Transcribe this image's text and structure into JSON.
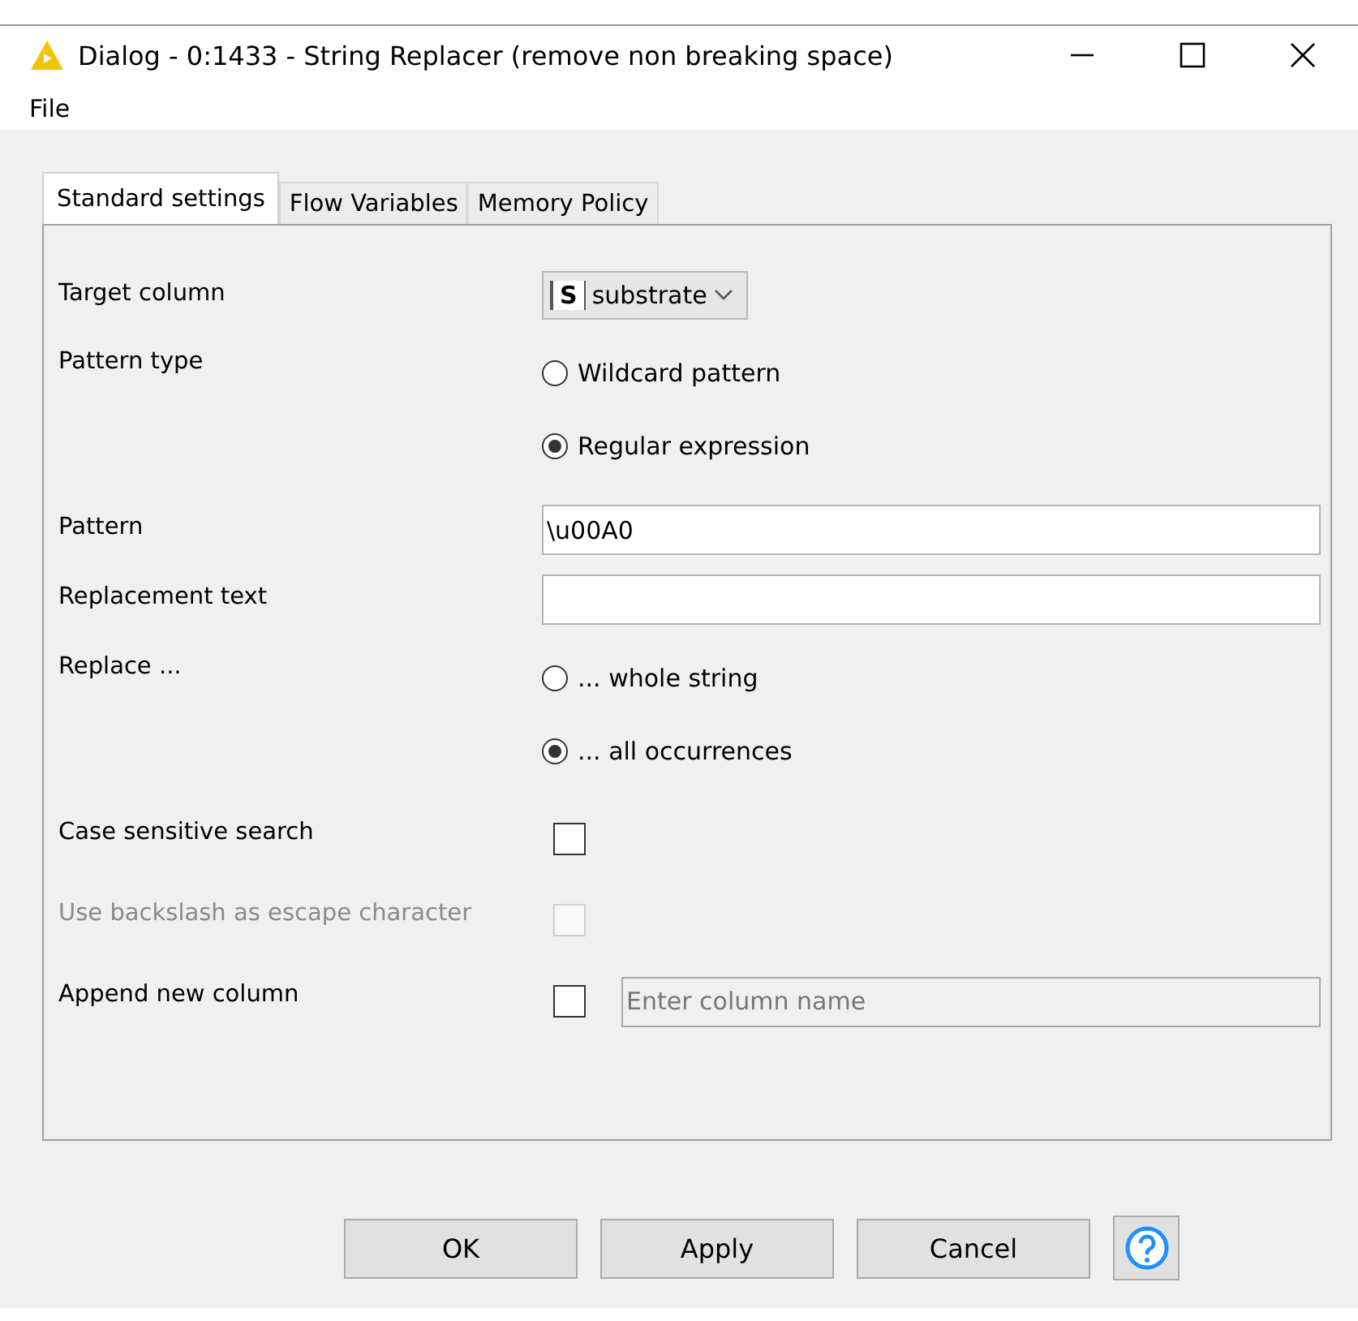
{
  "window": {
    "title": "Dialog - 0:1433 - String Replacer (remove non breaking space)"
  },
  "menu": [
    "File"
  ],
  "tabs": [
    {
      "label": "Standard settings",
      "selected": true
    },
    {
      "label": "Flow Variables",
      "selected": false
    },
    {
      "label": "Memory Policy",
      "selected": false
    }
  ],
  "rows": [
    {
      "kind": "dropdown",
      "label": "Target column",
      "type_badge": "S",
      "value": "substrate"
    },
    {
      "kind": "radio",
      "label": "Pattern type",
      "options": [
        {
          "label": "Wildcard pattern",
          "selected": false
        },
        {
          "label": "Regular expression",
          "selected": true
        }
      ]
    },
    {
      "kind": "text",
      "label": "Pattern",
      "value": "\\u00A0"
    },
    {
      "kind": "text",
      "label": "Replacement text"
    },
    {
      "kind": "radio",
      "label": "Replace ...",
      "options": [
        {
          "label": "... whole string",
          "selected": false
        },
        {
          "label": "... all occurrences",
          "selected": true
        }
      ]
    },
    {
      "kind": "checkbox",
      "label": "Case sensitive search",
      "checked": false,
      "disabled": false
    },
    {
      "kind": "checkbox",
      "label": "Use backslash as escape character",
      "checked": false,
      "disabled": true
    },
    {
      "kind": "checkbox_text",
      "label": "Append new column",
      "checked": false,
      "placeholder": "Enter column name"
    }
  ],
  "buttons": [
    "OK",
    "Apply",
    "Cancel"
  ]
}
